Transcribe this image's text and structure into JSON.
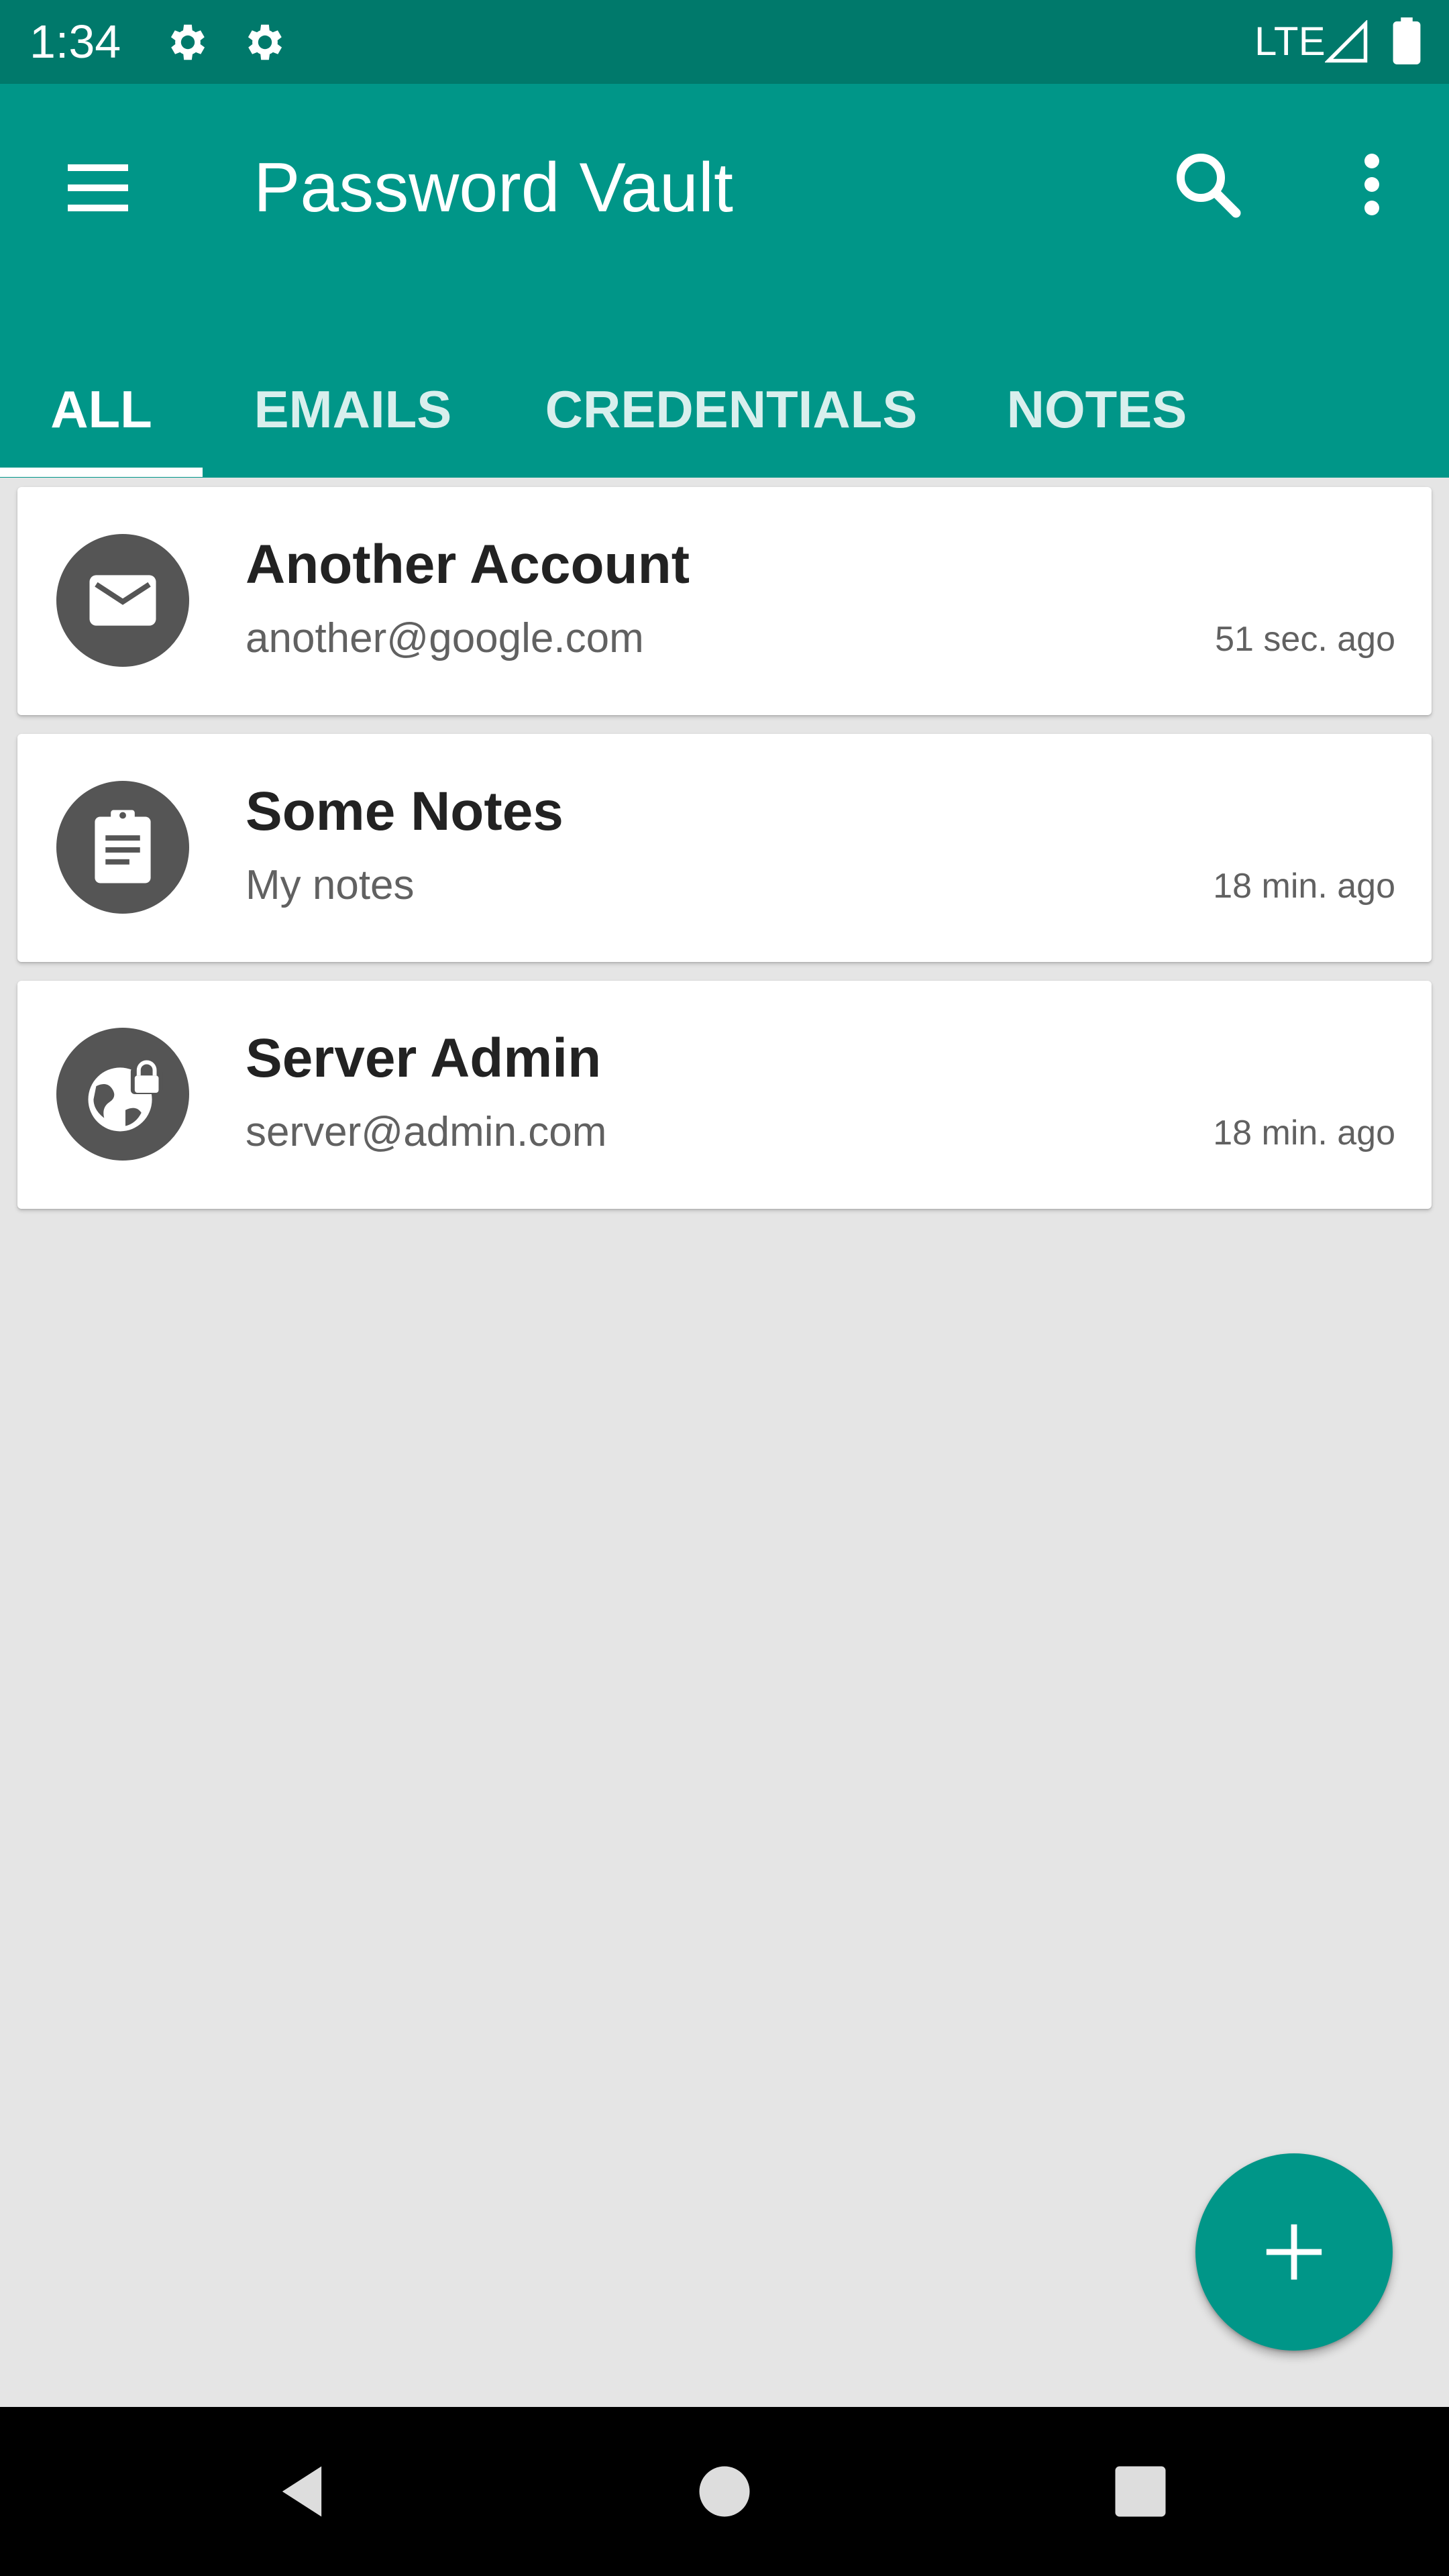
{
  "status_bar": {
    "time": "1:34",
    "network": "LTE",
    "icons": [
      "settings-icon",
      "settings-icon",
      "signal-icon",
      "battery-icon"
    ]
  },
  "app_bar": {
    "title": "Password Vault",
    "icons": [
      "menu-icon",
      "search-icon",
      "more-vert-icon"
    ]
  },
  "tabs": [
    {
      "label": "ALL",
      "selected": true
    },
    {
      "label": "EMAILS",
      "selected": false
    },
    {
      "label": "CREDENTIALS",
      "selected": false
    },
    {
      "label": "NOTES",
      "selected": false
    }
  ],
  "entries": [
    {
      "title": "Another Account",
      "subtitle": "another@google.com",
      "time": "51 sec. ago",
      "icon": "email-icon"
    },
    {
      "title": "Some Notes",
      "subtitle": "My notes",
      "time": "18 min. ago",
      "icon": "clipboard-note-icon"
    },
    {
      "title": "Server Admin",
      "subtitle": "server@admin.com",
      "time": "18 min. ago",
      "icon": "globe-lock-icon"
    }
  ],
  "fab": {
    "icon": "add-icon"
  },
  "nav": {
    "icons": [
      "back-icon",
      "home-icon",
      "recents-icon"
    ]
  },
  "colors": {
    "primary": "#009688",
    "primary_dark": "#00796b",
    "background": "#e5e5e5",
    "avatar": "#555555"
  }
}
